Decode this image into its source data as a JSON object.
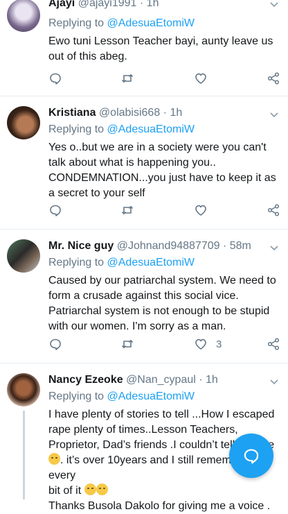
{
  "tweets": [
    {
      "name": "Ajayi",
      "handle": "@ajayi1991 · 1h",
      "replying_prefix": "Replying to ",
      "replying_to": "@AdesuaEtomiW",
      "lines": [
        "Ewo tuni Lesson Teacher bayi, aunty leave us",
        "out of this abeg."
      ],
      "like_count": ""
    },
    {
      "name": "Kristiana",
      "handle": "@olabisi668 · 1h",
      "replying_prefix": "Replying to ",
      "replying_to": "@AdesuaEtomiW",
      "lines": [
        "Yes o..but we are in a society were you can't",
        "talk about what is happening you..",
        "CONDEMNATION...you just have to keep it as",
        "a  secret to your self"
      ],
      "like_count": ""
    },
    {
      "name": "Mr. Nice guy",
      "handle": "@Johnand94887709 · 58m",
      "replying_prefix": "Replying to ",
      "replying_to": "@AdesuaEtomiW",
      "lines": [
        "Caused by our patriarchal system. We need to",
        "form a crusade against this social vice.",
        "Patriarchal system is not enough to be stupid",
        "with our women. I'm sorry as a man."
      ],
      "like_count": "3"
    },
    {
      "name": "Nancy Ezeoke",
      "handle": "@Nan_cypaul · 1h",
      "replying_prefix": "Replying to ",
      "replying_to": "@AdesuaEtomiW",
      "lines": [
        "I have plenty of stories to tell ...How I escaped",
        "rape plenty of times..Lesson Teachers,",
        "Proprietor, Dad’s friends .I couldn’t tell anyone",
        ". it’s over 10years and I still remember every",
        "bit of it",
        "Thanks Busola Dakolo for giving me a voice ."
      ],
      "like_count": ""
    }
  ],
  "icons": {
    "reply": "reply-icon",
    "retweet": "retweet-icon",
    "like": "heart-icon",
    "share": "share-icon",
    "more": "chevron-down-icon",
    "compose": "compose-reply-icon"
  },
  "colors": {
    "link": "#1da1f2",
    "muted": "#657786",
    "fab": "#1da1f2"
  }
}
